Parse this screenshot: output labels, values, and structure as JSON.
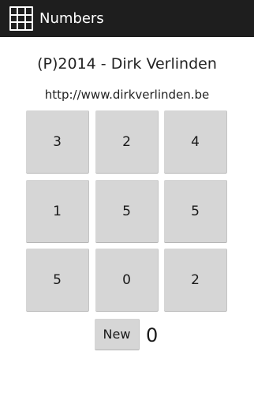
{
  "app": {
    "title": "Numbers",
    "icon": "number-grid-icon",
    "icon_digits": [
      "000",
      "000",
      "000"
    ]
  },
  "credit": "(P)2014 - Dirk Verlinden",
  "website": "http://www.dirkverlinden.be",
  "grid": [
    [
      "3",
      "2",
      "4"
    ],
    [
      "1",
      "5",
      "5"
    ],
    [
      "5",
      "0",
      "2"
    ]
  ],
  "controls": {
    "new_label": "New",
    "score": "0"
  },
  "colors": {
    "action_bar": "#1e1e1e",
    "button_bg": "#d6d6d6",
    "background": "#ffffff"
  }
}
